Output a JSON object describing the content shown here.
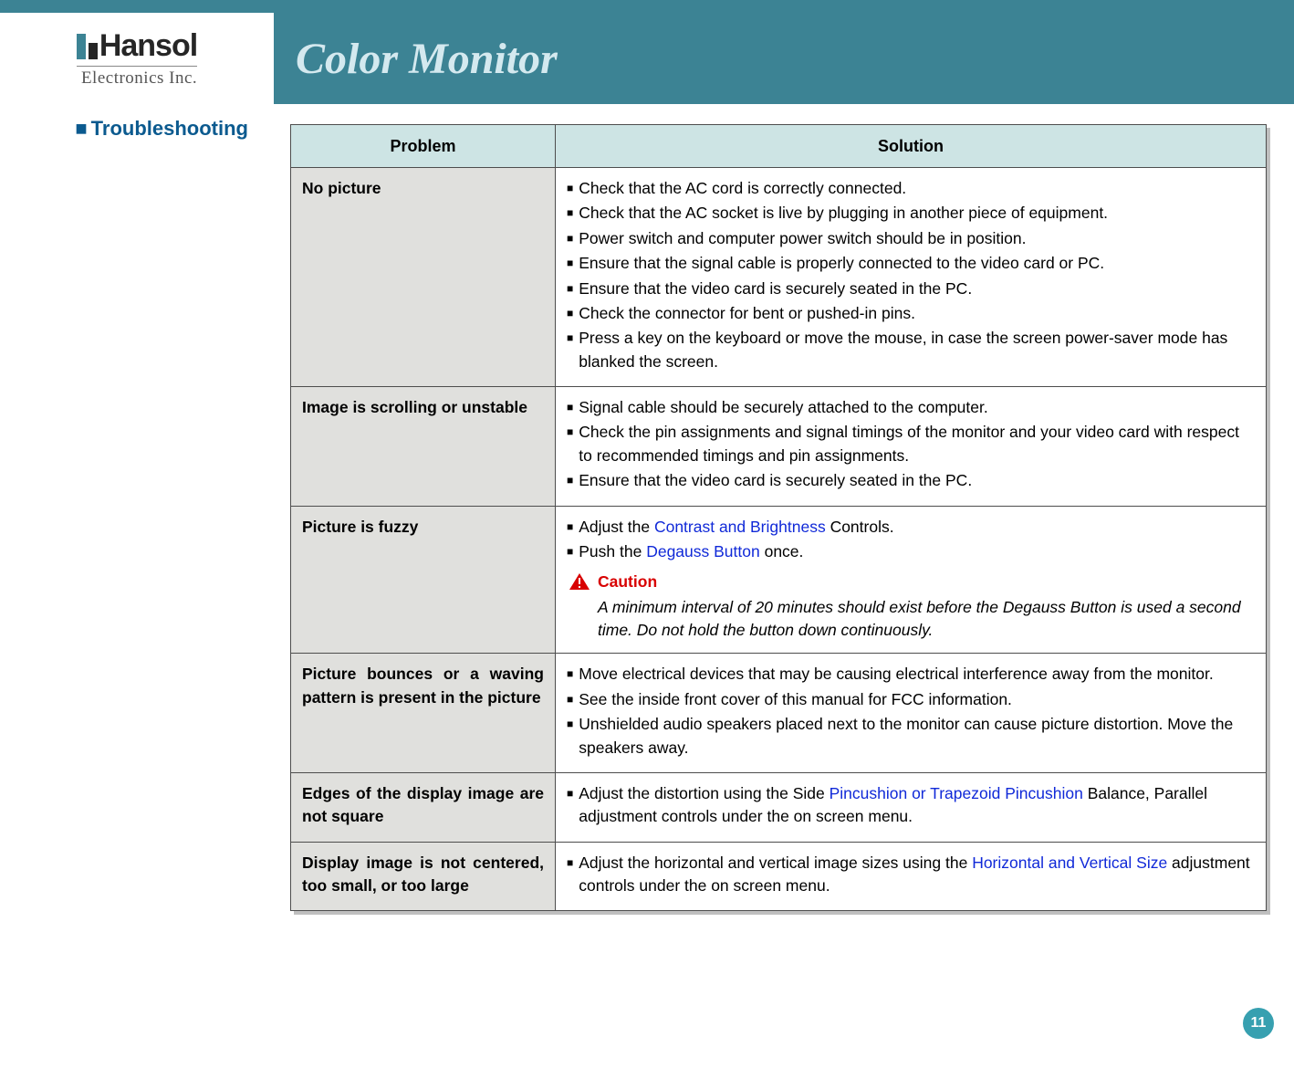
{
  "brand": {
    "name": "Hansol",
    "sub": "Electronics Inc."
  },
  "header": {
    "title": "Color Monitor"
  },
  "section": {
    "bullet": "■",
    "title": "Troubleshooting"
  },
  "table": {
    "col_problem": "Problem",
    "col_solution": "Solution",
    "rows": [
      {
        "problem": "No picture",
        "solutions": [
          [
            {
              "t": "Check that the AC cord is correctly connected."
            }
          ],
          [
            {
              "t": "Check that the AC socket is live by plugging in another piece of equipment."
            }
          ],
          [
            {
              "t": "Power switch and computer power switch should be in position."
            }
          ],
          [
            {
              "t": "Ensure that the signal cable is properly connected to the video card or PC."
            }
          ],
          [
            {
              "t": "Ensure that the video card is securely seated in the PC."
            }
          ],
          [
            {
              "t": "Check the connector for bent or pushed-in pins."
            }
          ],
          [
            {
              "t": "Press a key on the keyboard or move the mouse, in case the screen power-saver mode has blanked the screen."
            }
          ]
        ]
      },
      {
        "problem": "Image is scrolling or unstable",
        "solutions": [
          [
            {
              "t": "Signal cable should be securely attached to the computer."
            }
          ],
          [
            {
              "t": "Check the pin assignments and signal timings of the monitor and your video card with respect to recommended timings and pin assignments."
            }
          ],
          [
            {
              "t": "Ensure that the video card is securely seated in the PC."
            }
          ]
        ]
      },
      {
        "problem": "Picture is fuzzy",
        "solutions": [
          [
            {
              "t": "Adjust the "
            },
            {
              "t": "Contrast and Brightness",
              "blue": true
            },
            {
              "t": " Controls."
            }
          ],
          [
            {
              "t": "Push the "
            },
            {
              "t": "Degauss Button",
              "blue": true
            },
            {
              "t": " once."
            }
          ]
        ],
        "caution": {
          "label": "Caution",
          "body": "A minimum interval of 20 minutes should exist before the Degauss Button is used a second time. Do not hold the button down continuously."
        }
      },
      {
        "problem": "Picture bounces or a waving pattern is present in the picture",
        "solutions": [
          [
            {
              "t": "Move electrical devices that may be causing electrical interference away from the monitor."
            }
          ],
          [
            {
              "t": "See the inside front cover of this manual for FCC information."
            }
          ],
          [
            {
              "t": "Unshielded audio speakers placed next to the monitor can cause picture distortion. Move the speakers away."
            }
          ]
        ]
      },
      {
        "problem": "Edges of the display image are not square",
        "solutions": [
          [
            {
              "t": "Adjust the distortion using the Side "
            },
            {
              "t": "Pincushion or Trapezoid Pincushion",
              "blue": true
            },
            {
              "t": " Balance, Parallel adjustment controls under the on screen menu."
            }
          ]
        ]
      },
      {
        "problem": "Display image is not centered, too small, or too large",
        "solutions": [
          [
            {
              "t": "Adjust the horizontal and vertical image sizes using the "
            },
            {
              "t": "Horizontal and Vertical Size",
              "blue": true
            },
            {
              "t": " adjustment controls under the on screen menu."
            }
          ]
        ]
      }
    ]
  },
  "page_number": "11"
}
